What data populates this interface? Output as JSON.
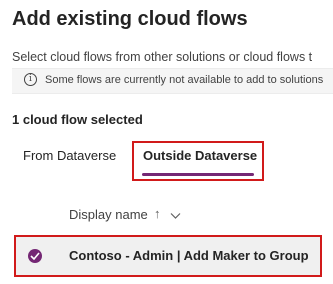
{
  "dialog": {
    "title": "Add existing cloud flows",
    "description": "Select cloud flows from other solutions or cloud flows t",
    "info_message": "Some flows are currently not available to add to solutions",
    "info_icon": "info-icon"
  },
  "selection": {
    "count_label": "1 cloud flow selected"
  },
  "tabs": [
    {
      "label": "From Dataverse",
      "selected": false
    },
    {
      "label": "Outside Dataverse",
      "selected": true
    }
  ],
  "table": {
    "columns": [
      {
        "label": "Display name",
        "sort": "ascending",
        "sort_icon": "arrow-up-icon",
        "menu_icon": "chevron-down-icon"
      }
    ],
    "rows": [
      {
        "display_name": "Contoso - Admin | Add Maker to Group",
        "selected": true
      }
    ]
  },
  "colors": {
    "accent": "#742774",
    "highlight_box": "#d11a1a",
    "selected_row_bg": "#f0f0f0"
  }
}
